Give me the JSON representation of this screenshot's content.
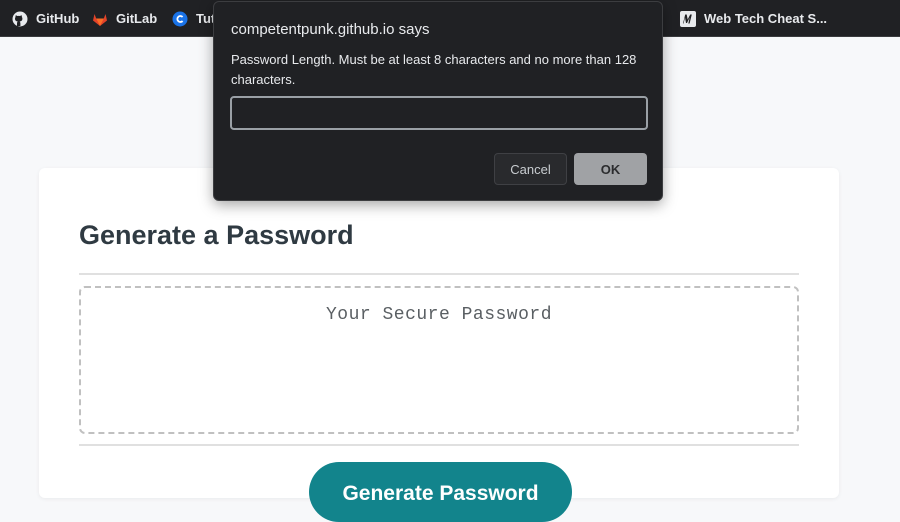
{
  "bookmarks": [
    {
      "label": "GitHub",
      "icon": "github-icon"
    },
    {
      "label": "GitLab",
      "icon": "gitlab-icon"
    },
    {
      "label": "Tut",
      "icon": "tutorial-icon"
    },
    {
      "label": "Web Tech Cheat S...",
      "icon": "cheatsheet-icon"
    }
  ],
  "dialog": {
    "origin": "competentpunk.github.io says",
    "message": "Password Length. Must be at least 8 characters and no more than 128 characters.",
    "input_value": "",
    "cancel_label": "Cancel",
    "ok_label": "OK"
  },
  "page": {
    "title": "Generate a Password",
    "password_placeholder": "Your Secure Password",
    "generate_label": "Generate Password"
  },
  "colors": {
    "accent": "#12848c",
    "bookmarks_bar": "#202124",
    "dialog_bg": "#202124",
    "ok_button": "#a0a2a5"
  }
}
